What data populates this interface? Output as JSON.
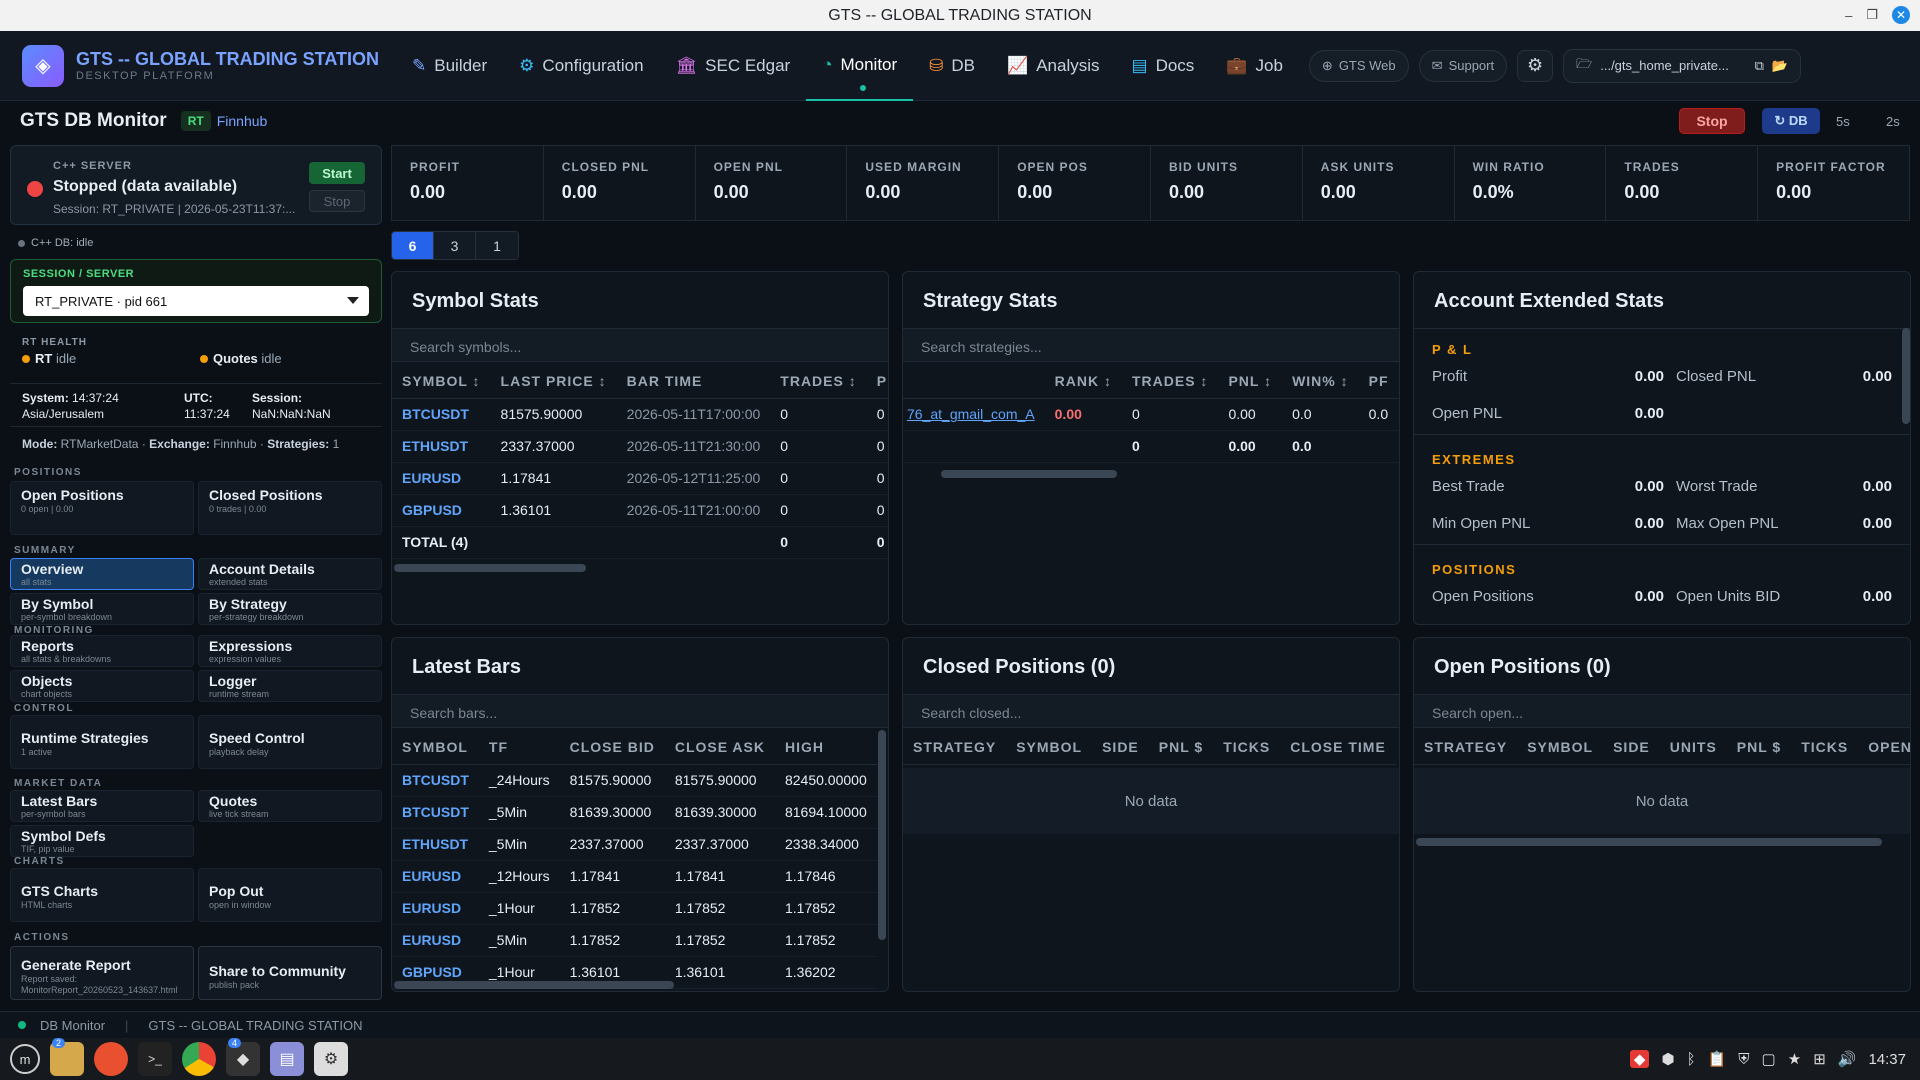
{
  "window": {
    "title": "GTS -- GLOBAL TRADING STATION"
  },
  "brand": {
    "title": "GTS -- GLOBAL TRADING STATION",
    "subtitle": "DESKTOP PLATFORM"
  },
  "nav": [
    {
      "label": "Builder",
      "icon": "pen-icon"
    },
    {
      "label": "Configuration",
      "icon": "gear-icon"
    },
    {
      "label": "SEC Edgar",
      "icon": "bank-icon"
    },
    {
      "label": "Monitor",
      "icon": "pulse-icon",
      "active": true
    },
    {
      "label": "DB",
      "icon": "database-icon"
    },
    {
      "label": "Analysis",
      "icon": "chart-icon"
    },
    {
      "label": "Docs",
      "icon": "book-icon"
    },
    {
      "label": "Job",
      "icon": "briefcase-icon"
    }
  ],
  "pills": {
    "web": "GTS Web",
    "support": "Support",
    "path": ".../gts_home_private..."
  },
  "header": {
    "title": "GTS DB Monitor",
    "rt": "RT",
    "feed": "Finnhub",
    "stop": "Stop",
    "db": "↻ DB",
    "t5": "5s",
    "t2": "2s"
  },
  "server": {
    "label": "C++ SERVER",
    "status": "Stopped (data available)",
    "session": "Session: RT_PRIVATE | 2026-05-23T11:37:...",
    "start": "Start",
    "stop": "Stop",
    "cppdb": "C++ DB: idle"
  },
  "session": {
    "label": "SESSION / SERVER",
    "value": "RT_PRIVATE · pid 661"
  },
  "rt_health": {
    "label": "RT HEALTH",
    "rt": "RT",
    "rt_state": "idle",
    "quotes": "Quotes",
    "quotes_state": "idle"
  },
  "sys": {
    "system_lbl": "System:",
    "system_time": "14:37:24",
    "system_tz": "Asia/Jerusalem",
    "utc_lbl": "UTC:",
    "utc_time": "11:37:24",
    "session_lbl": "Session:",
    "session_val": "NaN:NaN:NaN"
  },
  "mode": {
    "mode_lbl": "Mode:",
    "mode": "RTMarketData",
    "ex_lbl": "Exchange:",
    "exchange": "Finnhub",
    "st_lbl": "Strategies:",
    "strategies": "1"
  },
  "sections": {
    "positions": "POSITIONS",
    "summary": "SUMMARY",
    "monitoring": "MONITORING",
    "control": "CONTROL",
    "market": "MARKET DATA",
    "charts": "CHARTS",
    "actions": "ACTIONS"
  },
  "side": {
    "open_pos": {
      "m": "Open Positions",
      "s": "0 open | 0.00"
    },
    "closed_pos": {
      "m": "Closed Positions",
      "s": "0 trades | 0.00"
    },
    "overview": {
      "m": "Overview",
      "s": "all stats"
    },
    "account": {
      "m": "Account Details",
      "s": "extended stats"
    },
    "by_symbol": {
      "m": "By Symbol",
      "s": "per-symbol breakdown"
    },
    "by_strategy": {
      "m": "By Strategy",
      "s": "per-strategy breakdown"
    },
    "reports": {
      "m": "Reports",
      "s": "all stats & breakdowns"
    },
    "expressions": {
      "m": "Expressions",
      "s": "expression values"
    },
    "objects": {
      "m": "Objects",
      "s": "chart objects"
    },
    "logger": {
      "m": "Logger",
      "s": "runtime stream"
    },
    "runtime": {
      "m": "Runtime Strategies",
      "s": "1 active"
    },
    "speed": {
      "m": "Speed Control",
      "s": "playback delay"
    },
    "latest_bars": {
      "m": "Latest Bars",
      "s": "per-symbol bars"
    },
    "quotes": {
      "m": "Quotes",
      "s": "live tick stream"
    },
    "symdefs": {
      "m": "Symbol Defs",
      "s": "TIF, pip value"
    },
    "gts_charts": {
      "m": "GTS Charts",
      "s": "HTML charts"
    },
    "popout": {
      "m": "Pop Out",
      "s": "open in window"
    },
    "report": {
      "m": "Generate Report",
      "s1": "Report saved:",
      "s2": "MonitorReport_20260523_143637.html"
    },
    "share": {
      "m": "Share to Community",
      "s": "publish pack"
    }
  },
  "kpis": [
    {
      "k": "PROFIT",
      "v": "0.00"
    },
    {
      "k": "CLOSED PNL",
      "v": "0.00"
    },
    {
      "k": "OPEN PNL",
      "v": "0.00"
    },
    {
      "k": "USED MARGIN",
      "v": "0.00"
    },
    {
      "k": "OPEN POS",
      "v": "0.00"
    },
    {
      "k": "BID UNITS",
      "v": "0.00"
    },
    {
      "k": "ASK UNITS",
      "v": "0.00"
    },
    {
      "k": "WIN RATIO",
      "v": "0.0%"
    },
    {
      "k": "TRADES",
      "v": "0.00"
    },
    {
      "k": "PROFIT FACTOR",
      "v": "0.00"
    }
  ],
  "grid_seg": [
    "6",
    "3",
    "1"
  ],
  "symbol_stats": {
    "title": "Symbol Stats",
    "search": "Search symbols...",
    "cols": [
      "SYMBOL ↕",
      "LAST PRICE ↕",
      "BAR TIME",
      "TRADES ↕",
      "P"
    ],
    "rows": [
      [
        "BTCUSDT",
        "81575.90000",
        "2026-05-11T17:00:00",
        "0",
        "0"
      ],
      [
        "ETHUSDT",
        "2337.37000",
        "2026-05-11T21:30:00",
        "0",
        "0"
      ],
      [
        "EURUSD",
        "1.17841",
        "2026-05-12T11:25:00",
        "0",
        "0"
      ],
      [
        "GBPUSD",
        "1.36101",
        "2026-05-11T21:00:00",
        "0",
        "0"
      ]
    ],
    "total": [
      "TOTAL (4)",
      "",
      "",
      "0",
      "0"
    ]
  },
  "strategy_stats": {
    "title": "Strategy Stats",
    "search": "Search strategies...",
    "cols": [
      "",
      "RANK ↕",
      "TRADES ↕",
      "PNL ↕",
      "WIN% ↕",
      "PF"
    ],
    "row": [
      "76_at_gmail_com_A",
      "0.00",
      "0",
      "0.00",
      "0.0",
      "0.0"
    ],
    "total": [
      "",
      "",
      "0",
      "0.00",
      "0.0",
      ""
    ]
  },
  "account": {
    "title": "Account Extended Stats",
    "pl": "P & L",
    "profit": "Profit",
    "profit_v": "0.00",
    "closed": "Closed PNL",
    "closed_v": "0.00",
    "open": "Open PNL",
    "open_v": "0.00",
    "extremes": "EXTREMES",
    "best": "Best Trade",
    "best_v": "0.00",
    "worst": "Worst Trade",
    "worst_v": "0.00",
    "minop": "Min Open PNL",
    "minop_v": "0.00",
    "maxop": "Max Open PNL",
    "maxop_v": "0.00",
    "positions": "POSITIONS",
    "openpos": "Open Positions",
    "openpos_v": "0.00",
    "bid": "Open Units BID",
    "bid_v": "0.00"
  },
  "latest_bars": {
    "title": "Latest Bars",
    "search": "Search bars...",
    "cols": [
      "SYMBOL",
      "TF",
      "CLOSE BID",
      "CLOSE ASK",
      "HIGH"
    ],
    "rows": [
      [
        "BTCUSDT",
        "_24Hours",
        "81575.90000",
        "81575.90000",
        "82450.00000"
      ],
      [
        "BTCUSDT",
        "_5Min",
        "81639.30000",
        "81639.30000",
        "81694.10000"
      ],
      [
        "ETHUSDT",
        "_5Min",
        "2337.37000",
        "2337.37000",
        "2338.34000"
      ],
      [
        "EURUSD",
        "_12Hours",
        "1.17841",
        "1.17841",
        "1.17846"
      ],
      [
        "EURUSD",
        "_1Hour",
        "1.17852",
        "1.17852",
        "1.17852"
      ],
      [
        "EURUSD",
        "_5Min",
        "1.17852",
        "1.17852",
        "1.17852"
      ],
      [
        "GBPUSD",
        "_1Hour",
        "1.36101",
        "1.36101",
        "1.36202"
      ]
    ]
  },
  "closed_positions": {
    "title": "Closed Positions (0)",
    "search": "Search closed...",
    "cols": [
      "STRATEGY",
      "SYMBOL",
      "SIDE",
      "PNL $",
      "TICKS",
      "CLOSE TIME"
    ],
    "empty": "No data"
  },
  "open_positions": {
    "title": "Open Positions (0)",
    "search": "Search open...",
    "cols": [
      "STRATEGY",
      "SYMBOL",
      "SIDE",
      "UNITS",
      "PNL $",
      "TICKS",
      "OPEN TI"
    ],
    "empty": "No data"
  },
  "status": {
    "left": "DB Monitor",
    "right": "GTS -- GLOBAL TRADING STATION"
  },
  "taskbar": {
    "badge1": "2",
    "badge2": "4",
    "clock": "14:37"
  }
}
